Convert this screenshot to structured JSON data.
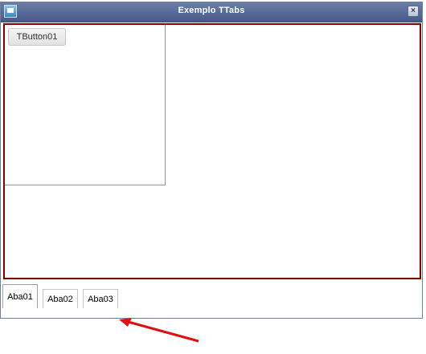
{
  "window": {
    "title": "Exemplo TTabs",
    "close_label": "×"
  },
  "content": {
    "button_label": "TButton01"
  },
  "tabs": [
    {
      "label": "Aba01",
      "active": true
    },
    {
      "label": "Aba02",
      "active": false
    },
    {
      "label": "Aba03",
      "active": false
    }
  ],
  "colors": {
    "panel_border": "#800000",
    "titlebar": "#46598a",
    "annotation_arrow": "#e01010"
  },
  "icons": {
    "app": "window-app-icon",
    "close": "close-icon"
  }
}
